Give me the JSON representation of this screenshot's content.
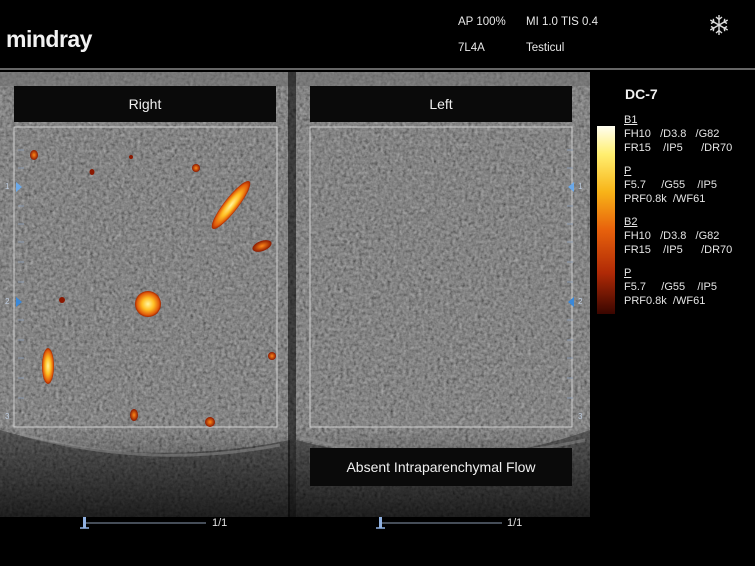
{
  "brand": "mindray",
  "header": {
    "ap": "AP 100%",
    "mi_tis": "MI 1.0 TIS 0.4",
    "probe": "7L4A",
    "preset": "Testicul"
  },
  "mode": "DC-7",
  "panes": {
    "right_label": "Right",
    "left_label": "Left",
    "annotation": "Absent Intraparenchymal Flow"
  },
  "depth_marks": [
    "1",
    "2",
    "3"
  ],
  "page_indicator": "1/1",
  "params": {
    "b1": {
      "title": "B1",
      "r1": [
        "FH10",
        "/D3.8",
        "/G82"
      ],
      "r2": [
        "FR15",
        "/IP5",
        "/DR70"
      ]
    },
    "p1": {
      "title": "P",
      "r1": [
        "F5.7",
        "/G55",
        "/IP5"
      ],
      "r2": [
        "PRF0.8k",
        "/WF61"
      ]
    },
    "b2": {
      "title": "B2",
      "r1": [
        "FH10",
        "/D3.8",
        "/G82"
      ],
      "r2": [
        "FR15",
        "/IP5",
        "/DR70"
      ]
    },
    "p2": {
      "title": "P",
      "r1": [
        "F5.7",
        "/G55",
        "/IP5"
      ],
      "r2": [
        "PRF0.8k",
        "/WF61"
      ]
    }
  },
  "colors": {
    "roi_box": "#cfcfcf",
    "flow_high": "#ffe860",
    "flow_low": "#c02800"
  }
}
